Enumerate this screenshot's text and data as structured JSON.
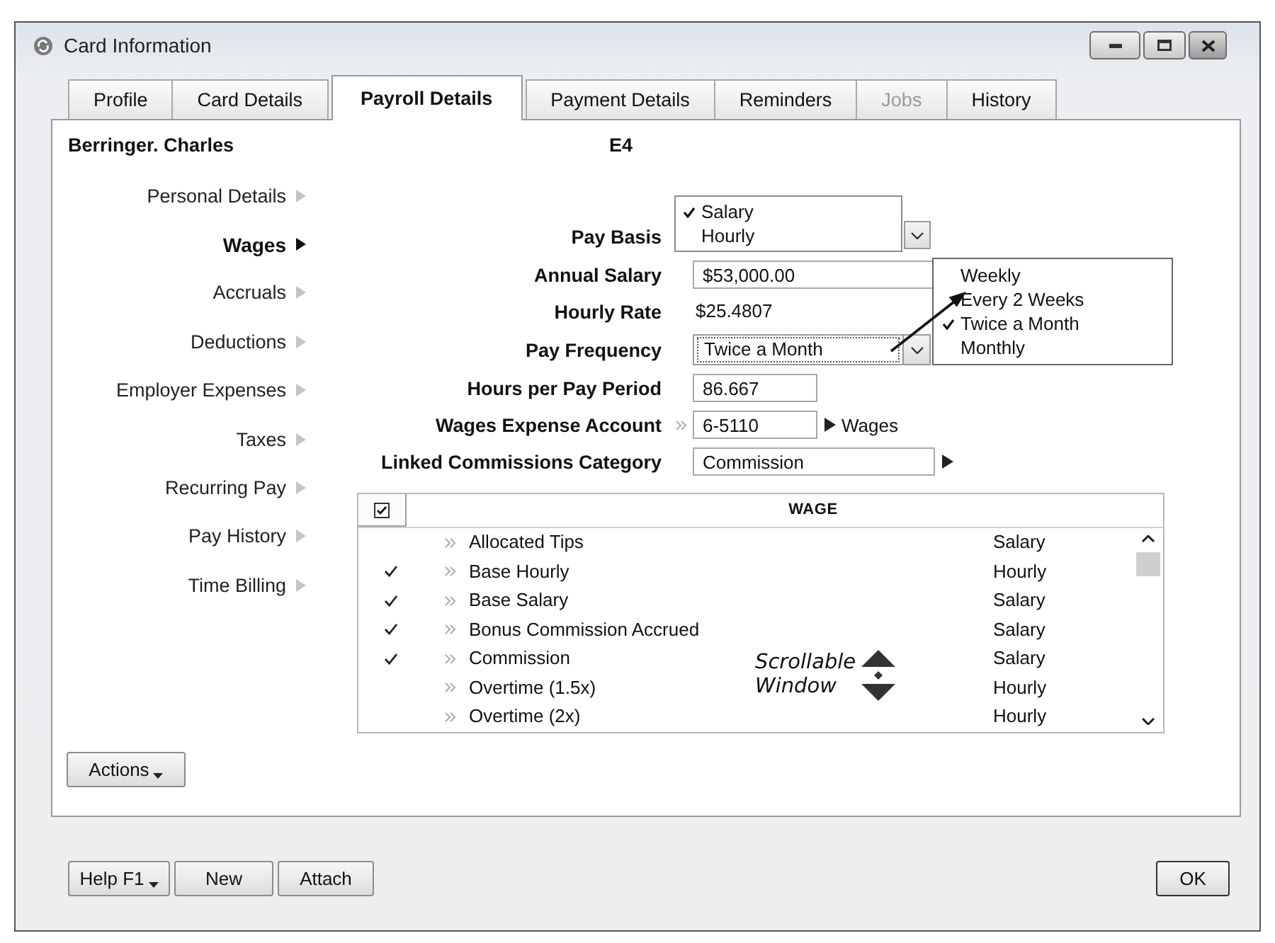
{
  "window": {
    "title": "Card Information"
  },
  "tabs": [
    {
      "label": "Profile",
      "selected": false,
      "disabled": false
    },
    {
      "label": "Card Details",
      "selected": false,
      "disabled": false
    },
    {
      "label": "Payroll Details",
      "selected": true,
      "disabled": false
    },
    {
      "label": "Payment Details",
      "selected": false,
      "disabled": false
    },
    {
      "label": "Reminders",
      "selected": false,
      "disabled": false
    },
    {
      "label": "Jobs",
      "selected": false,
      "disabled": true
    },
    {
      "label": "History",
      "selected": false,
      "disabled": false
    }
  ],
  "sidebar": {
    "name": "Berringer. Charles",
    "items": [
      {
        "label": "Personal Details",
        "selected": false
      },
      {
        "label": "Wages",
        "selected": true
      },
      {
        "label": "Accruals",
        "selected": false
      },
      {
        "label": "Deductions",
        "selected": false
      },
      {
        "label": "Employer Expenses",
        "selected": false
      },
      {
        "label": "Taxes",
        "selected": false
      },
      {
        "label": "Recurring Pay",
        "selected": false
      },
      {
        "label": "Pay History",
        "selected": false
      },
      {
        "label": "Time Billing",
        "selected": false
      }
    ],
    "actions_button": {
      "label": "Actions",
      "menu": true
    }
  },
  "card_id": "E4",
  "form": {
    "fields": [
      {
        "kind": "listbox",
        "label": "Pay Basis",
        "options": [
          {
            "label": "Salary",
            "selected": true
          },
          {
            "label": "Hourly",
            "selected": false
          }
        ]
      },
      {
        "kind": "input",
        "label": "Annual Salary",
        "value": "$53,000.00"
      },
      {
        "kind": "text",
        "label": "Hourly Rate",
        "value": "$25.4807"
      },
      {
        "kind": "combo",
        "label": "Pay Frequency",
        "value": "Twice a Month",
        "expanded": true,
        "options": [
          {
            "label": "Weekly",
            "selected": false
          },
          {
            "label": "Every 2 Weeks",
            "selected": false
          },
          {
            "label": "Twice a Month",
            "selected": true
          },
          {
            "label": "Monthly",
            "selected": false
          }
        ]
      },
      {
        "kind": "number",
        "label": "Hours per Pay Period",
        "value": "86.667"
      },
      {
        "kind": "account",
        "label": "Wages Expense Account",
        "value": "6-5110",
        "account_name": "Wages"
      },
      {
        "kind": "lookup",
        "label": "Linked Commissions Category",
        "value": "Commission"
      }
    ]
  },
  "table": {
    "select_all_checked": true,
    "column": "WAGE",
    "rows": [
      {
        "checked": false,
        "wage": "Allocated Tips",
        "column_3": "Salary"
      },
      {
        "checked": true,
        "wage": "Base Hourly",
        "column_3": "Hourly"
      },
      {
        "checked": true,
        "wage": "Base Salary",
        "column_3": "Salary"
      },
      {
        "checked": true,
        "wage": "Bonus Commission Accrued",
        "column_3": "Salary"
      },
      {
        "checked": true,
        "wage": "Commission",
        "column_3": "Salary"
      },
      {
        "checked": false,
        "wage": "Overtime (1.5x)",
        "column_3": "Hourly"
      },
      {
        "checked": false,
        "wage": "Overtime (2x)",
        "column_3": "Hourly"
      }
    ],
    "annotation": "Scrollable Window"
  },
  "footer": {
    "buttons": [
      {
        "label": "Help F1",
        "menu": true
      },
      {
        "label": "New",
        "menu": false
      },
      {
        "label": "Attach",
        "menu": false
      }
    ],
    "ok_button": {
      "label": "OK"
    }
  }
}
